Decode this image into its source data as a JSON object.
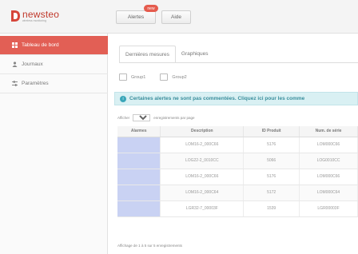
{
  "app": {
    "logo_name": "newsteo",
    "logo_tagline": "wireless monitoring"
  },
  "topbar": {
    "alerts_label": "Alertes",
    "alerts_badge": "new",
    "help_label": "Aide"
  },
  "sidebar": {
    "items": [
      {
        "label": "Tableau de bord",
        "icon": "dashboard-icon",
        "active": true
      },
      {
        "label": "Journaux",
        "icon": "user-icon",
        "active": false
      },
      {
        "label": "Paramètres",
        "icon": "settings-icon",
        "active": false
      }
    ]
  },
  "tabs": [
    {
      "label": "Dernières mesures",
      "active": true
    },
    {
      "label": "Graphiques",
      "active": false
    }
  ],
  "groups": [
    {
      "label": "Group1"
    },
    {
      "label": "Group2"
    }
  ],
  "alert_message": "Certaines alertes ne sont pas commentées. Cliquez ici pour les comme",
  "table_length": {
    "prefix": "Afficher",
    "value": "100",
    "suffix": "enregistrements par page"
  },
  "table": {
    "columns": [
      "Alarmes",
      "Description",
      "ID Produit",
      "Num. de série"
    ],
    "rows": [
      {
        "description": "LOM16-2_000C66",
        "product_id": "5176",
        "serial": "LOM000C66"
      },
      {
        "description": "LOG22-2_0010CC",
        "product_id": "5066",
        "serial": "LOG0010CC"
      },
      {
        "description": "LOM16-2_000C66",
        "product_id": "5176",
        "serial": "LOM000C66"
      },
      {
        "description": "LOM16-2_000C64",
        "product_id": "5172",
        "serial": "LOM000C64"
      },
      {
        "description": "LGR32-7_00003F",
        "product_id": "1539",
        "serial": "LGR00003F"
      }
    ]
  },
  "table_info": "Affichage de 1 à 5 sur 5 enregistrements",
  "colors": {
    "accent": "#e25f55",
    "alarm_cell": "#c9d2f3",
    "info_bg": "#d9f0f3",
    "info_text": "#3a8e9c"
  }
}
